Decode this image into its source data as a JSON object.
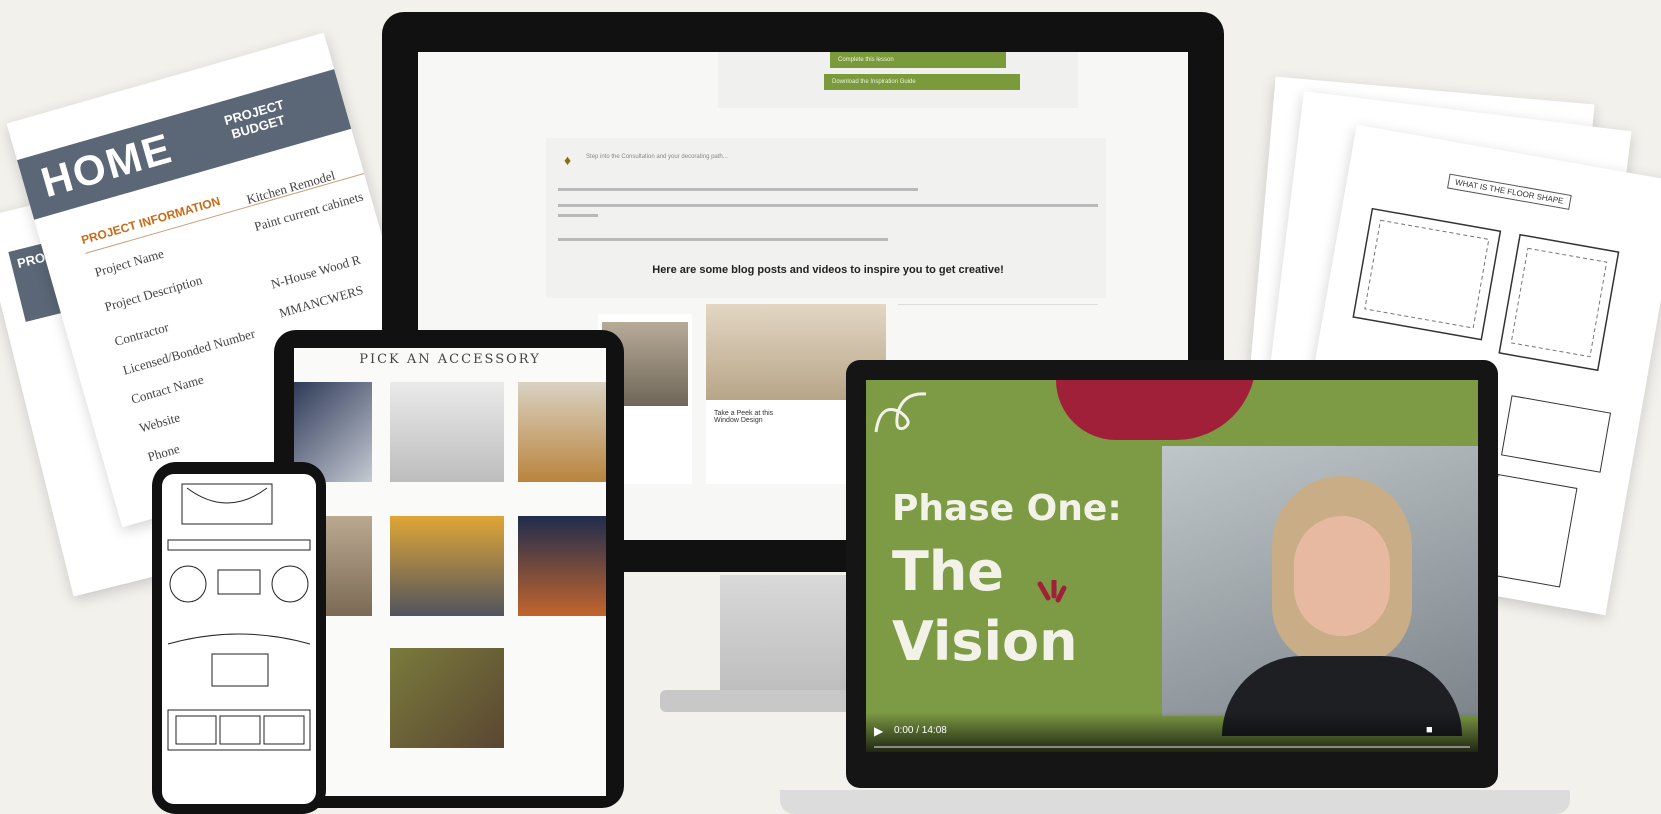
{
  "budget_sheet": {
    "brand": "HOME",
    "header": "PROJECT BUDGET",
    "section": "PROJECT INFORMATION",
    "rows": [
      "Project Name",
      "Project Description",
      "Contractor",
      "Licensed/Bonded Number",
      "Contact Name",
      "Website",
      "Phone"
    ],
    "value_col": [
      "Kitchen Remodel",
      "Paint current cabinets",
      "N-House Wood R",
      "MMANCWERS"
    ],
    "back_sheet_label": "PRO BUD"
  },
  "floor_plan_sheet": {
    "title": "WHAT IS THE FLOOR SHAPE"
  },
  "monitor_page": {
    "buttons": [
      "Complete this lesson",
      "Download the Inspiration Guide"
    ],
    "intro": "Step into the Consultation and your decorating path...",
    "headline": "Here are some blog posts and videos to inspire you to get creative!",
    "cards": [
      "Take a Peek at this Window Design"
    ]
  },
  "tablet": {
    "heading": "PICK AN ACCESSORY"
  },
  "video": {
    "title_line1": "Phase One:",
    "title_line2": "The",
    "title_line3": "Vision",
    "time": "0:00 / 14:08",
    "colors": {
      "bg": "#7d9a45",
      "accent": "#a0203a"
    }
  }
}
